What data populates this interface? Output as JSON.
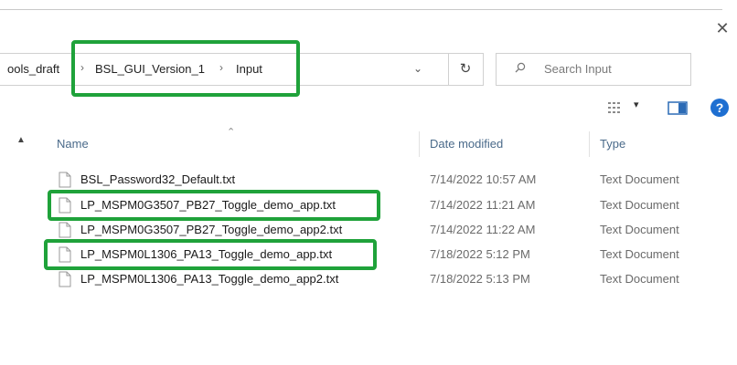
{
  "window": {
    "close_glyph": "✕"
  },
  "address_bar": {
    "crumbs": [
      "ools_draft",
      "BSL_GUI_Version_1",
      "Input"
    ],
    "separator": "›",
    "chevron": "⌄",
    "refresh_glyph": "↻"
  },
  "search": {
    "placeholder": "Search Input"
  },
  "toolbar": {
    "view_chevron": "▾",
    "help_glyph": "?"
  },
  "nav": {
    "scroll_up_glyph": "▲"
  },
  "columns": {
    "name": "Name",
    "date": "Date modified",
    "type": "Type",
    "sort_glyph": "⌃"
  },
  "files": [
    {
      "name": "BSL_Password32_Default.txt",
      "date": "7/14/2022 10:57 AM",
      "type": "Text Document",
      "highlighted": false
    },
    {
      "name": "LP_MSPM0G3507_PB27_Toggle_demo_app.txt",
      "date": "7/14/2022 11:21 AM",
      "type": "Text Document",
      "highlighted": true
    },
    {
      "name": "LP_MSPM0G3507_PB27_Toggle_demo_app2.txt",
      "date": "7/14/2022 11:22 AM",
      "type": "Text Document",
      "highlighted": false
    },
    {
      "name": "LP_MSPM0L1306_PA13_Toggle_demo_app.txt",
      "date": "7/18/2022 5:12 PM",
      "type": "Text Document",
      "highlighted": true
    },
    {
      "name": "LP_MSPM0L1306_PA13_Toggle_demo_app2.txt",
      "date": "7/18/2022 5:13 PM",
      "type": "Text Document",
      "highlighted": false
    }
  ],
  "colors": {
    "highlight": "#1fa23a",
    "help_icon": "#1e6fd1",
    "header_text": "#4a6a8a"
  }
}
